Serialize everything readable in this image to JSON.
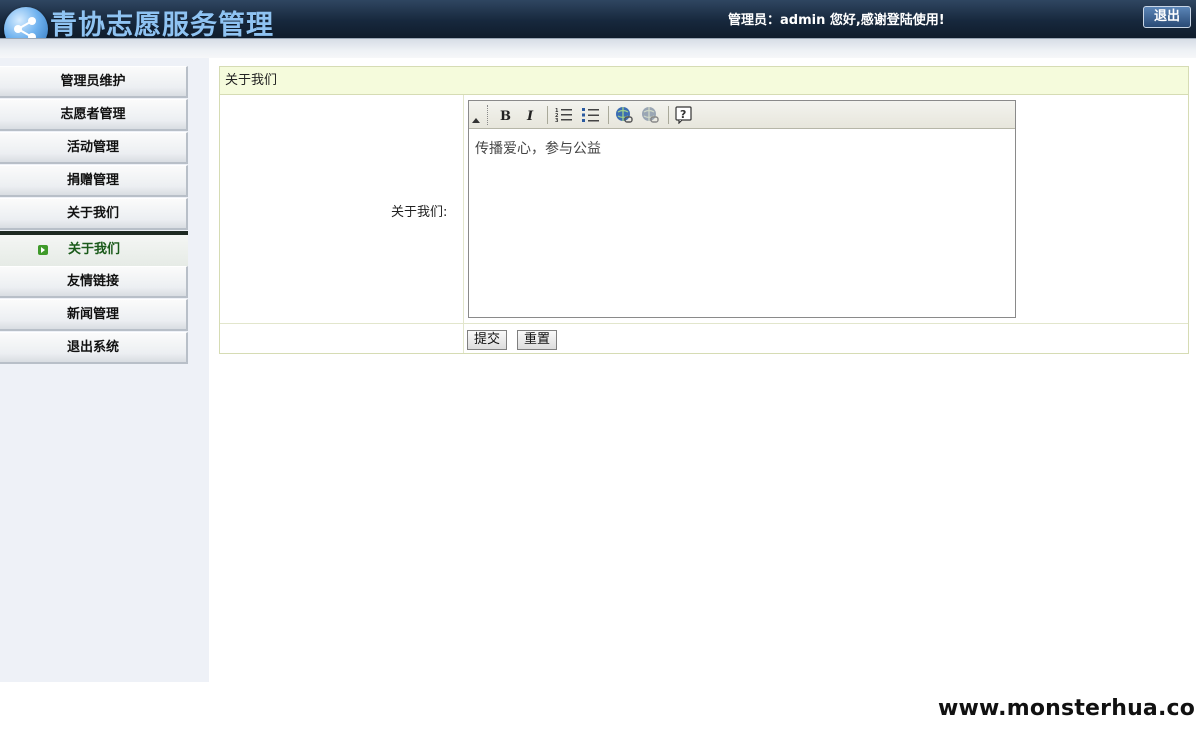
{
  "header": {
    "app_title": "青协志愿服务管理",
    "greeting": "管理员：admin 您好,感谢登陆使用!",
    "logout_label": "退出"
  },
  "sidebar": {
    "items": [
      {
        "label": "管理员维护"
      },
      {
        "label": "志愿者管理"
      },
      {
        "label": "活动管理"
      },
      {
        "label": "捐赠管理"
      },
      {
        "label": "关于我们"
      }
    ],
    "sub_item": {
      "label": "关于我们"
    },
    "items_after": [
      {
        "label": "友情链接"
      },
      {
        "label": "新闻管理"
      },
      {
        "label": "退出系统"
      }
    ]
  },
  "panel": {
    "title": "关于我们",
    "field_label": "关于我们:",
    "editor_content": "传播爱心，参与公益",
    "submit_label": "提交",
    "reset_label": "重置"
  },
  "toolbar": {
    "icons": [
      "bold-icon",
      "italic-icon",
      "ordered-list-icon",
      "unordered-list-icon",
      "link-icon",
      "unlink-icon",
      "help-icon"
    ]
  },
  "watermark": "www.monsterhua.com",
  "colors": {
    "header_dark": "#17283d",
    "title_blue": "#8fc3f2",
    "panel_title_bg": "#f5fbdc",
    "sidebar_bg": "#eef1f7",
    "active_green": "#1a5a1a"
  }
}
